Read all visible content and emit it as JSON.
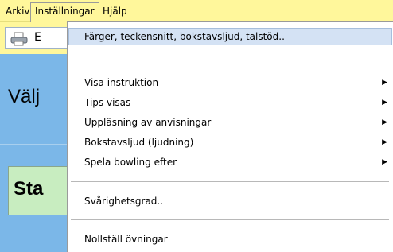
{
  "menubar": {
    "items": [
      {
        "label": "Arkiv"
      },
      {
        "label": "Inställningar"
      },
      {
        "label": "Hjälp"
      }
    ]
  },
  "toolbar": {
    "button_label": "E"
  },
  "main": {
    "heading_partial": "Välj",
    "start_partial": "Sta"
  },
  "dropdown": {
    "items": [
      {
        "label": "Färger, teckensnitt, bokstavsljud, talstöd..",
        "submenu": false
      },
      {
        "label": "Visa instruktion",
        "submenu": true
      },
      {
        "label": "Tips visas",
        "submenu": true
      },
      {
        "label": "Uppläsning av anvisningar",
        "submenu": true
      },
      {
        "label": "Bokstavsljud (ljudning)",
        "submenu": true
      },
      {
        "label": "Spela bowling efter",
        "submenu": true
      },
      {
        "label": "Svårighetsgrad..",
        "submenu": false
      },
      {
        "label": "Nollställ övningar",
        "submenu": false
      }
    ],
    "submenu_arrow": "▶"
  },
  "colors": {
    "menubar_bg": "#fff79b",
    "main_bg": "#7bb7e8",
    "start_bg": "#c8edc0",
    "highlight": "#d4e2f4"
  }
}
